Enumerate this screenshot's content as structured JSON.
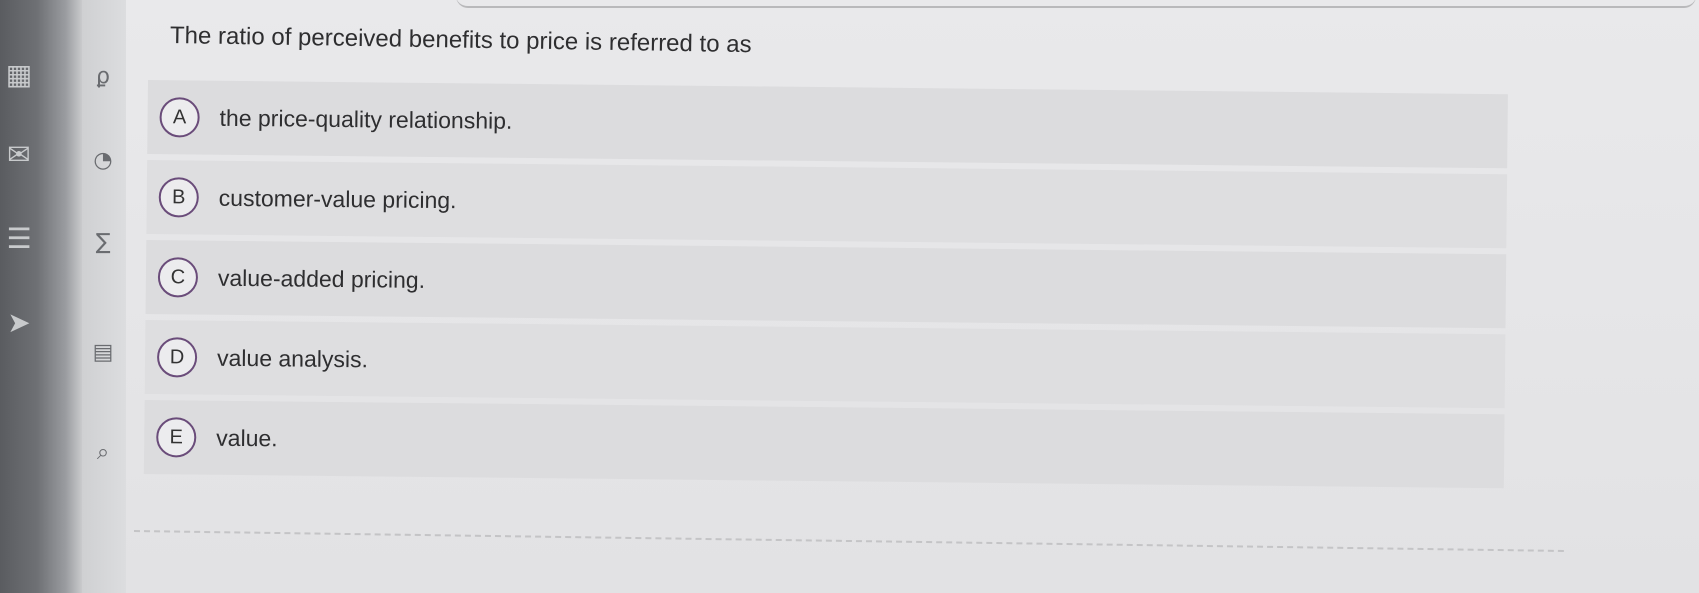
{
  "question": {
    "text": "The ratio of perceived benefits to price is referred to as"
  },
  "options": [
    {
      "letter": "A",
      "text": "the price-quality relationship."
    },
    {
      "letter": "B",
      "text": "customer-value pricing."
    },
    {
      "letter": "C",
      "text": "value-added pricing."
    },
    {
      "letter": "D",
      "text": "value analysis."
    },
    {
      "letter": "E",
      "text": "value."
    }
  ],
  "left_strip": {
    "icons": [
      "calculator-icon",
      "mail-icon",
      "list-icon",
      "cursor-icon"
    ]
  },
  "tool_column": {
    "icons": [
      "user-icon",
      "clock-icon",
      "sum-icon",
      "document-icon",
      "attachment-icon"
    ]
  },
  "colors": {
    "panel": "#e5e5e7",
    "option_row": "#dcdcde",
    "letter_border": "#6a4c7a",
    "left_strip": "#6e7074"
  }
}
